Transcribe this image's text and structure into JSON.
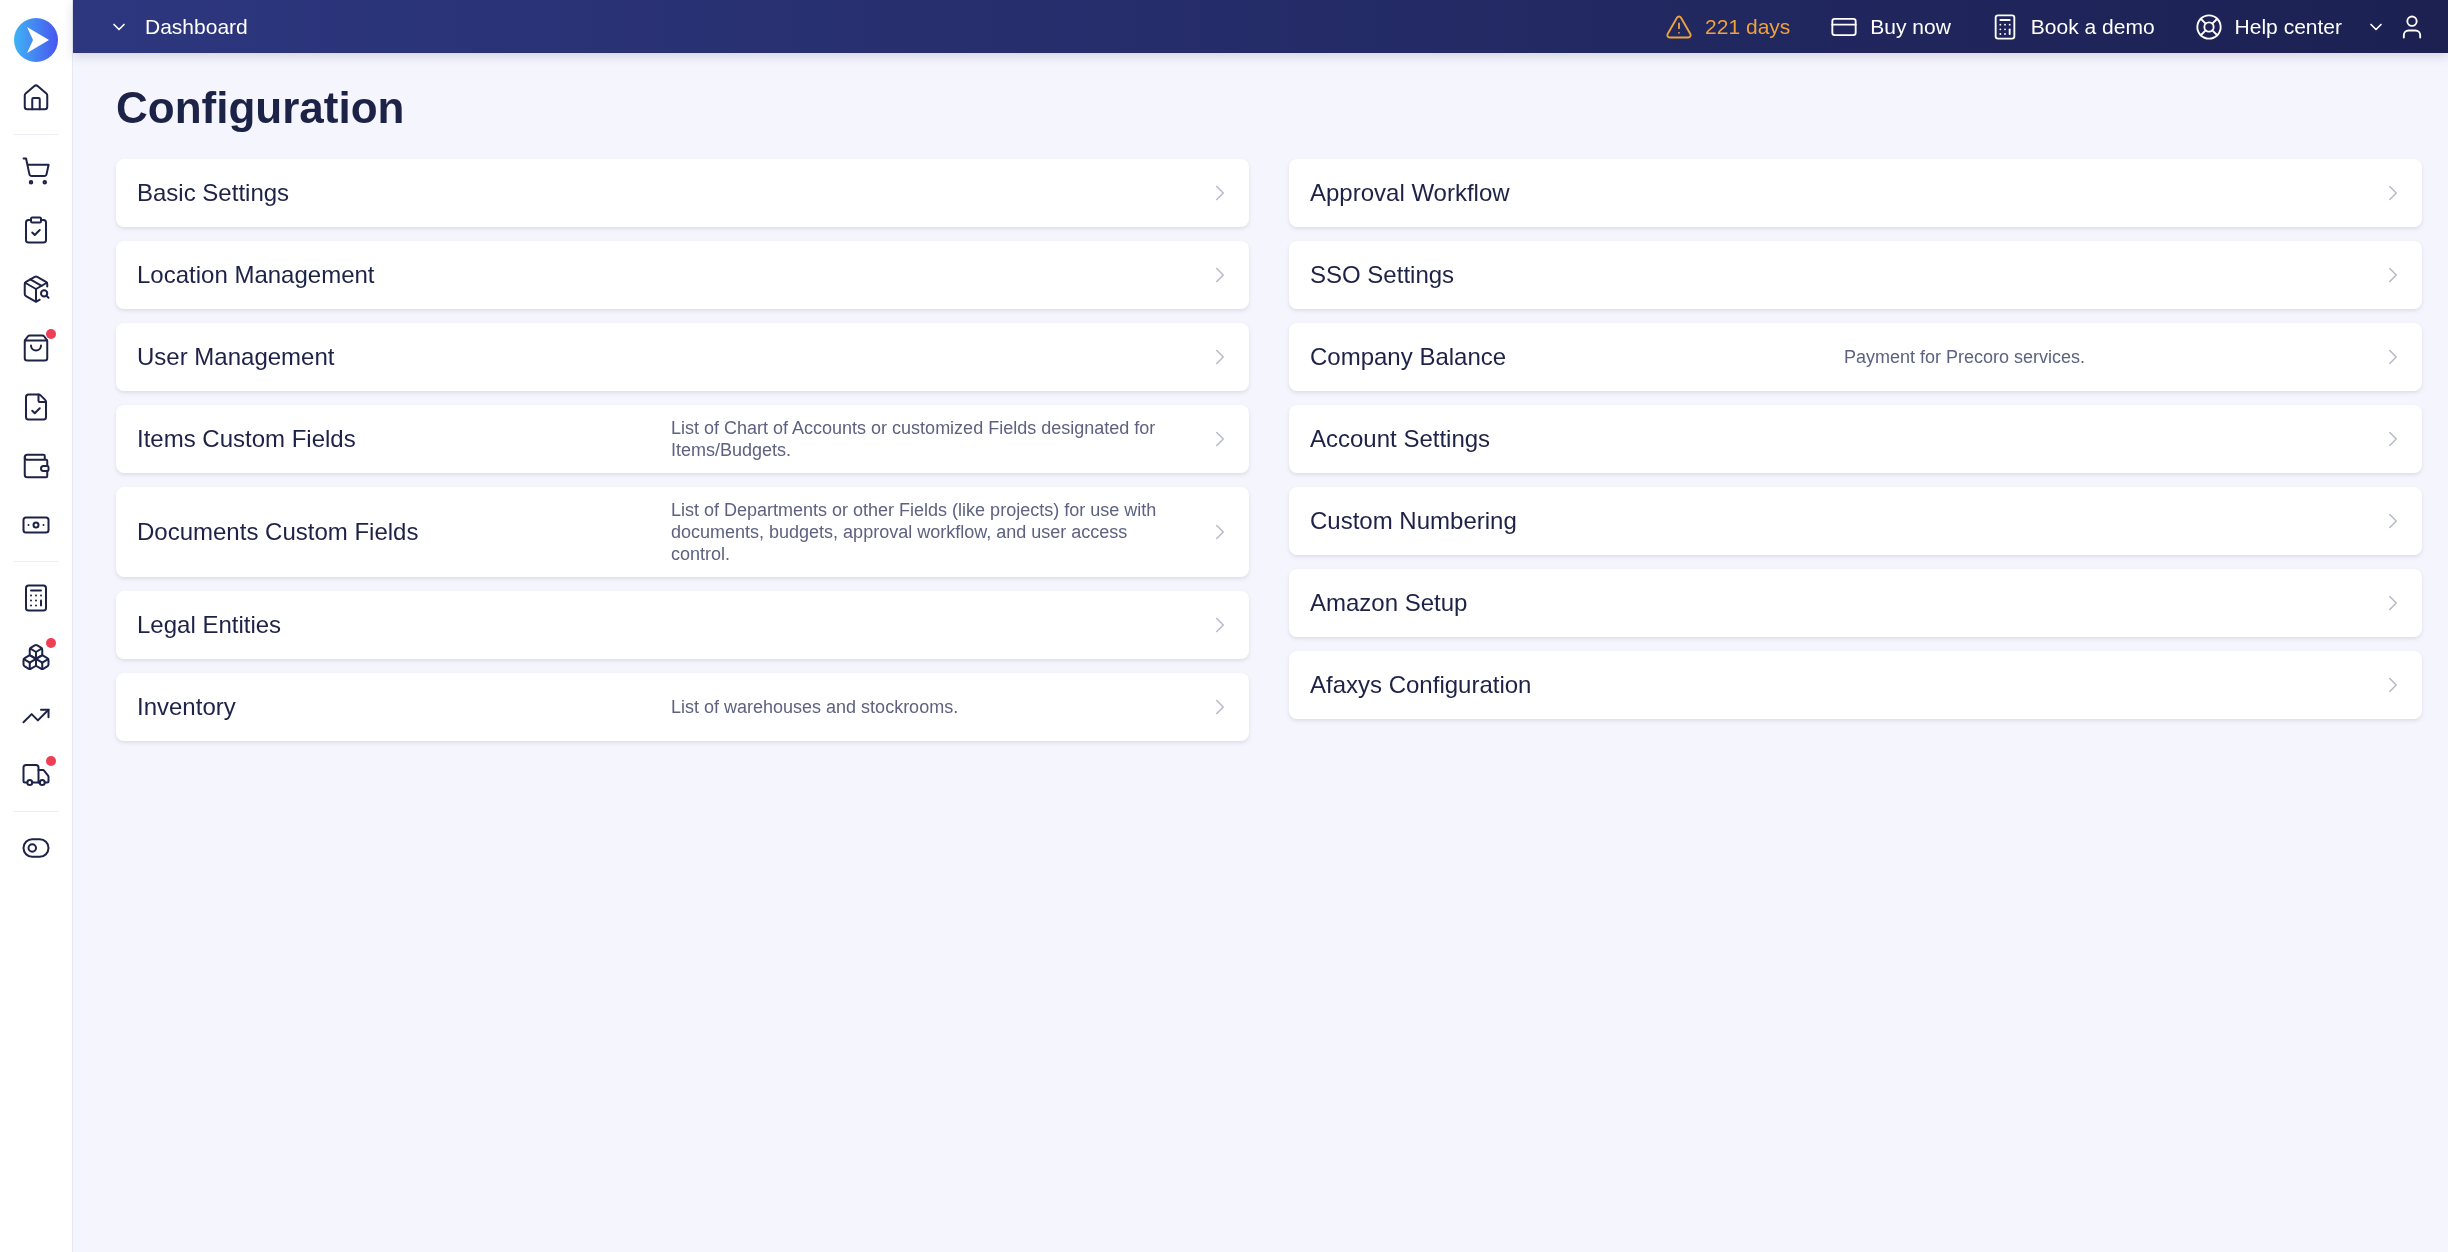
{
  "sidebar": {
    "groups": [
      {
        "items": [
          {
            "badge": false
          }
        ]
      },
      {
        "items": [
          {
            "badge": false
          },
          {
            "badge": false
          },
          {
            "badge": false
          },
          {
            "badge": true
          },
          {
            "badge": false
          },
          {
            "badge": false
          },
          {
            "badge": false
          }
        ]
      },
      {
        "items": [
          {
            "badge": false
          },
          {
            "badge": true
          },
          {
            "badge": false
          },
          {
            "badge": true
          }
        ]
      },
      {
        "items": [
          {
            "badge": false
          }
        ]
      }
    ]
  },
  "top_bar": {
    "breadcrumb": "Dashboard",
    "links": [
      {
        "kind": "warning",
        "label": "221 days"
      },
      {
        "kind": "card",
        "label": "Buy now"
      },
      {
        "kind": "calculator",
        "label": "Book a demo"
      },
      {
        "kind": "help",
        "label": "Help center"
      }
    ]
  },
  "page_title": "Configuration",
  "columns": [
    [
      {
        "title": "Basic Settings"
      },
      {
        "title": "Location Management"
      },
      {
        "title": "User Management"
      },
      {
        "title": "Items Custom Fields",
        "description": "List of Chart of Accounts or customized Fields designated for Items/Budgets."
      },
      {
        "title": "Documents Custom Fields",
        "description": "List of Departments or other Fields (like projects) for use with documents, budgets, approval workflow, and user access control."
      },
      {
        "title": "Legal Entities"
      },
      {
        "title": "Inventory",
        "description": "List of warehouses and stockrooms."
      }
    ],
    [
      {
        "title": "Approval Workflow"
      },
      {
        "title": "SSO Settings"
      },
      {
        "title": "Company Balance",
        "description": "Payment for Precoro services."
      },
      {
        "title": "Account Settings"
      },
      {
        "title": "Custom Numbering"
      },
      {
        "title": "Amazon Setup"
      },
      {
        "title": "Afaxys Configuration"
      }
    ]
  ]
}
